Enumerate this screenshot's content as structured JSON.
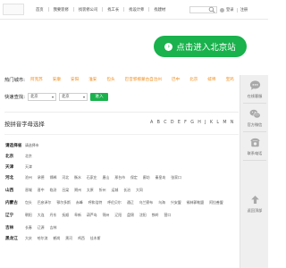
{
  "nav": {
    "items": [
      "首页",
      "我要装修",
      "找装修公司",
      "找工长",
      "找设计师",
      "找建材"
    ]
  },
  "user": {
    "login_label": "登录",
    "register_label": "注册"
  },
  "enter_button": {
    "label": "点击进入北京站"
  },
  "hot_cities": {
    "label": "热门城市:",
    "items": [
      "阿克苏",
      "安康",
      "安阳",
      "淮安",
      "包头",
      "巴音郭楞蒙古自治州",
      "巴中",
      "北京",
      "蚌埠",
      "宝鸡"
    ]
  },
  "quick_select": {
    "label": "快速查找:",
    "province_value": "北京",
    "city_value": "北京",
    "go_label": "进入"
  },
  "letter_index": {
    "title": "按拼音字母选择",
    "letters": [
      "A",
      "B",
      "C",
      "D",
      "E",
      "F",
      "G",
      "H",
      "J",
      "K",
      "L",
      "M",
      "N"
    ]
  },
  "provinces": [
    {
      "name": "请选择省",
      "cities": [
        "请选择市"
      ]
    },
    {
      "name": "北京",
      "cities": [
        "北京"
      ]
    },
    {
      "name": "天津",
      "cities": [
        "天津"
      ]
    },
    {
      "name": "河北",
      "cities": [
        "沧州",
        "承德",
        "邯郸",
        "河北",
        "衡水",
        "石家庄",
        "唐山",
        "邢台市",
        "保定",
        "廊坊",
        "秦皇岛",
        "张家口"
      ]
    },
    {
      "name": "山西",
      "cities": [
        "晋城",
        "晋中",
        "临汾",
        "吕梁",
        "朔州",
        "太原",
        "忻州",
        "运城",
        "长治",
        "大同"
      ]
    },
    {
      "name": "内蒙古",
      "cities": [
        "包头",
        "巴彦淖尔",
        "鄂尔多斯",
        "赤峰",
        "呼和浩特",
        "呼伦贝尔",
        "通辽",
        "乌兰察布",
        "乌海",
        "兴安盟",
        "锡林郭勒盟",
        "阿拉善盟"
      ]
    },
    {
      "name": "辽宁",
      "cities": [
        "朝阳",
        "大连",
        "丹东",
        "抚顺",
        "阜新",
        "葫芦岛",
        "锦州",
        "辽阳",
        "盘锦",
        "沈阳",
        "铁岭",
        "营口"
      ]
    },
    {
      "name": "吉林",
      "cities": [
        "长春",
        "辽源",
        "吉林"
      ]
    },
    {
      "name": "黑龙江",
      "cities": [
        "大庆",
        "哈尔滨",
        "鹤岗",
        "黑河",
        "鸡西",
        "佳木斯"
      ]
    }
  ],
  "sidebar": {
    "items": [
      "在线客服",
      "官方微信",
      "联系电话",
      "返回顶部"
    ]
  },
  "colors": {
    "accent_green": "#19b24c",
    "hot_city_orange": "#f08b18"
  }
}
